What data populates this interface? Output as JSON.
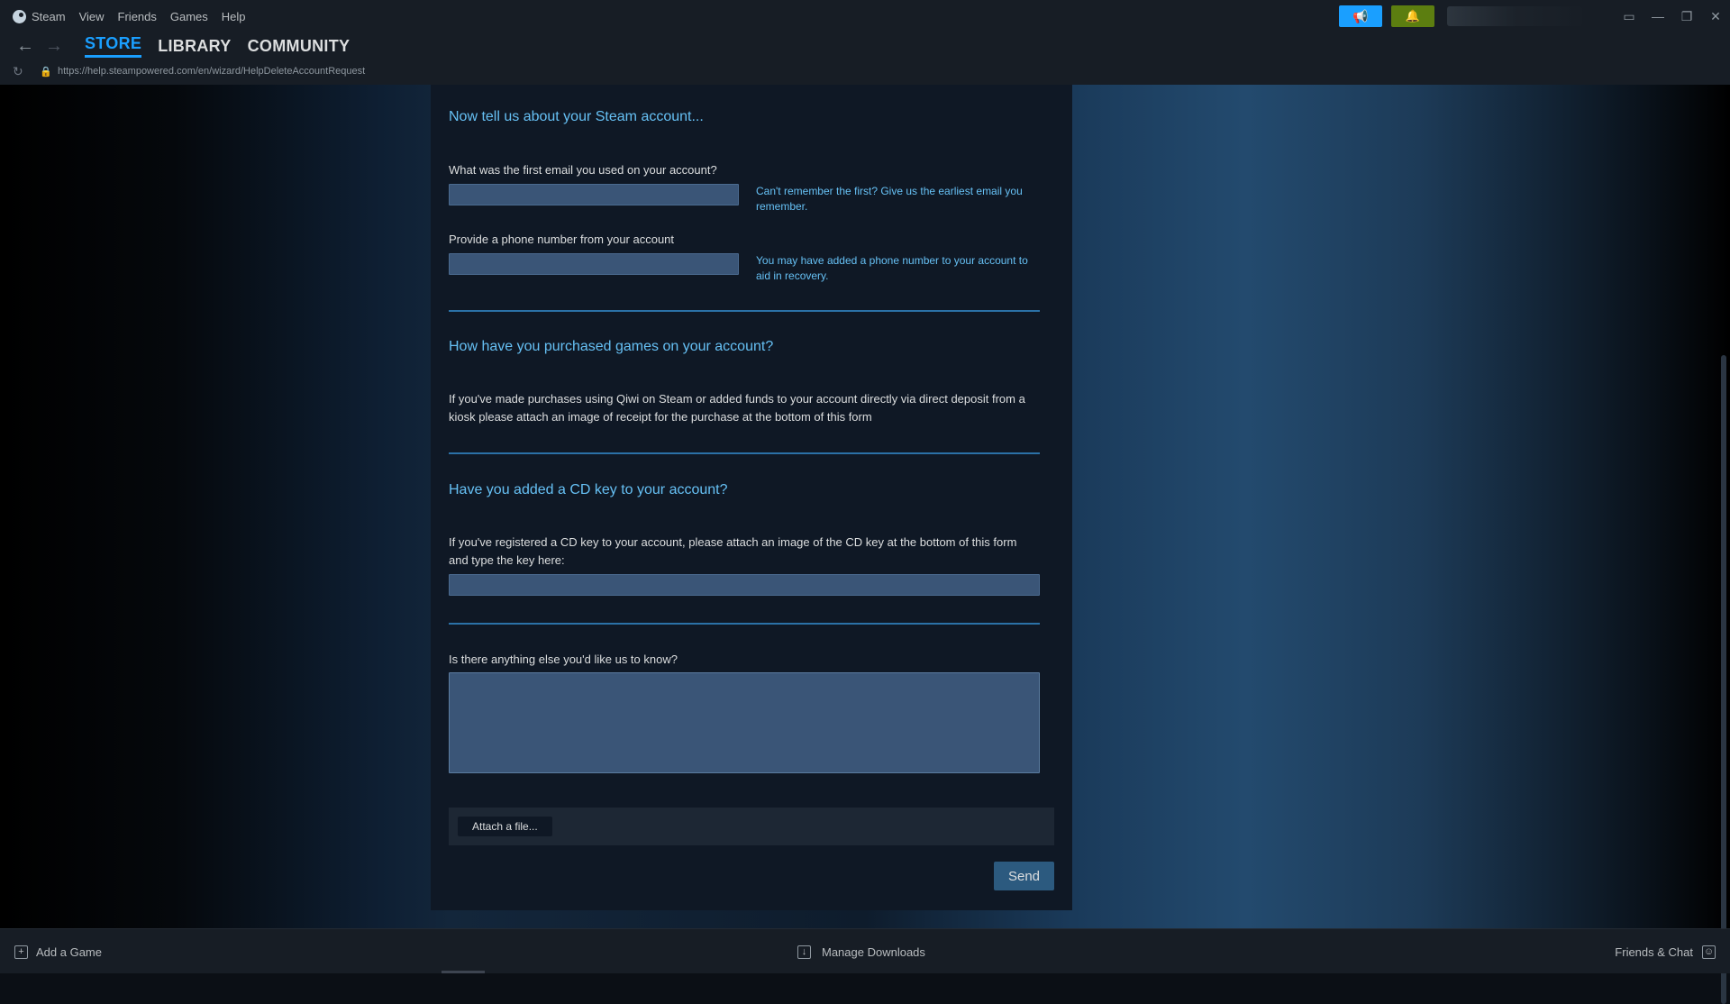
{
  "menu": {
    "app_name": "Steam",
    "items": [
      "View",
      "Friends",
      "Games",
      "Help"
    ]
  },
  "nav": {
    "tabs": [
      {
        "label": "STORE",
        "active": true
      },
      {
        "label": "LIBRARY",
        "active": false
      },
      {
        "label": "COMMUNITY",
        "active": false
      }
    ],
    "url": "https://help.steampowered.com/en/wizard/HelpDeleteAccountRequest"
  },
  "form": {
    "section1_title": "Now tell us about your Steam account...",
    "email_label": "What was the first email you used on your account?",
    "email_value": "",
    "email_hint": "Can't remember the first? Give us the earliest email you remember.",
    "phone_label": "Provide a phone number from your account",
    "phone_value": "",
    "phone_hint": "You may have added a phone number to your account to aid in recovery.",
    "section2_title": "How have you purchased games on your account?",
    "purchase_text": "If you've made purchases using Qiwi on Steam or added funds to your account directly via direct deposit from a kiosk please attach an image of receipt for the purchase at the bottom of this form",
    "section3_title": "Have you added a CD key to your account?",
    "cdkey_text": "If you've registered a CD key to your account, please attach an image of the CD key at the bottom of this form and type the key here:",
    "cdkey_value": "",
    "other_label": "Is there anything else you'd like us to know?",
    "other_value": "",
    "attach_label": "Attach a file...",
    "send_label": "Send"
  },
  "bottom": {
    "add_game": "Add a Game",
    "manage_downloads": "Manage Downloads",
    "friends_chat": "Friends & Chat"
  },
  "colors": {
    "accent": "#1a9fff",
    "link": "#66c0f4",
    "announce_button": "#1a9fff",
    "notification_button": "#5c7e10"
  },
  "icons": {
    "back": "arrow-left-icon",
    "forward": "arrow-right-icon",
    "refresh": "refresh-icon",
    "lock": "lock-icon",
    "announce": "megaphone-icon",
    "notifications": "bell-icon"
  }
}
